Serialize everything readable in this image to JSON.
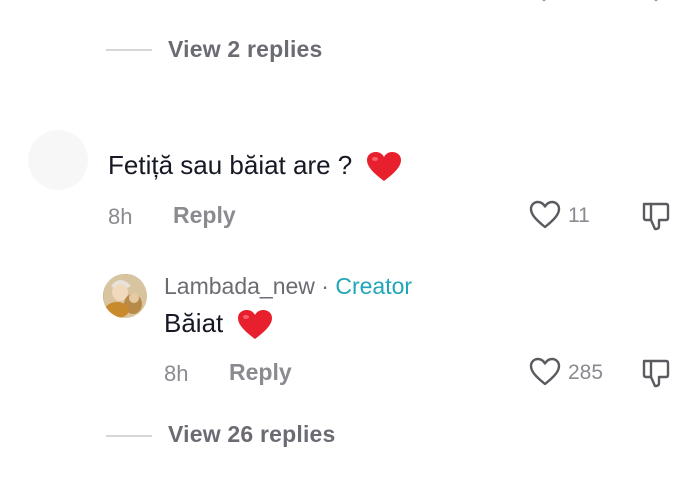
{
  "thread_top": {
    "view_replies_label": "View 2 replies"
  },
  "comment1": {
    "text": "Fetiță sau băiat are ?",
    "time": "8h",
    "reply_label": "Reply",
    "like_count": "11",
    "emoji": "red-heart-emoji"
  },
  "reply1": {
    "username": "Lambada_new",
    "separator": " · ",
    "badge": "Creator",
    "text": "Băiat",
    "time": "8h",
    "reply_label": "Reply",
    "like_count": "285",
    "emoji": "red-heart-emoji"
  },
  "thread_bottom": {
    "view_replies_label": "View 26 replies"
  },
  "colors": {
    "creator_badge": "#20a6b8",
    "heart": "#e8202e",
    "muted_text": "#8a8b91"
  }
}
